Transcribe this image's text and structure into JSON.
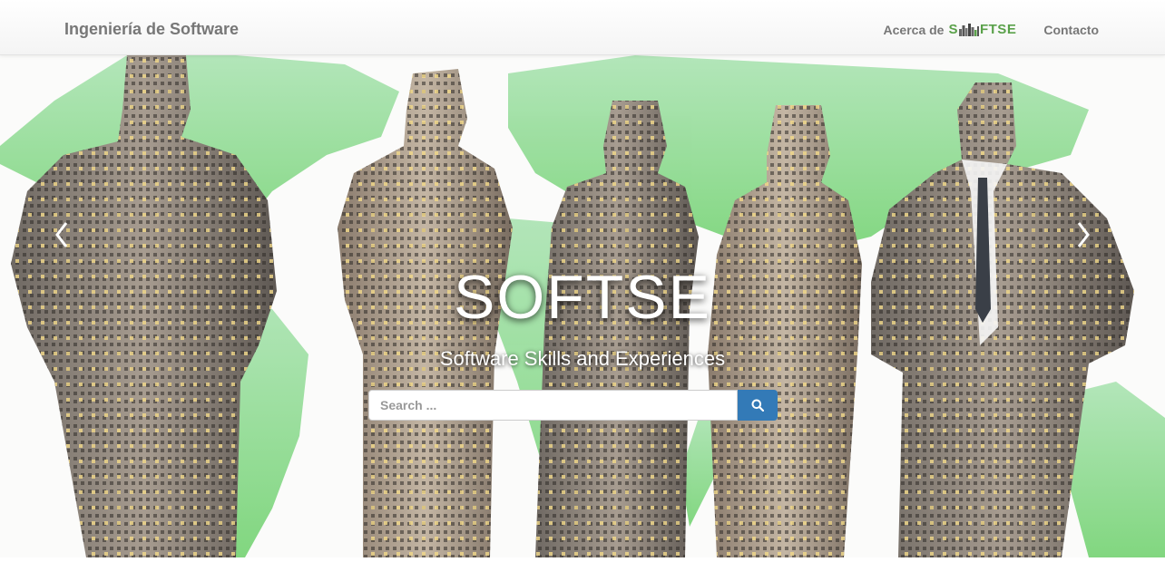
{
  "navbar": {
    "brand": "Ingeniería de Software",
    "about_prefix": "Acerca de",
    "about_logo_s": "S",
    "about_logo_rest": "FTSE",
    "contact": "Contacto"
  },
  "hero": {
    "title": "SOFTSE",
    "subtitle": "Software Skills and Experiences"
  },
  "search": {
    "placeholder": "Search ..."
  },
  "carousel": {
    "prev_icon": "chevron-left-icon",
    "next_icon": "chevron-right-icon"
  },
  "colors": {
    "accent": "#337ab7",
    "logo_green": "#5aa14a",
    "map_green": "#7fd67f",
    "nav_text": "#777777"
  }
}
